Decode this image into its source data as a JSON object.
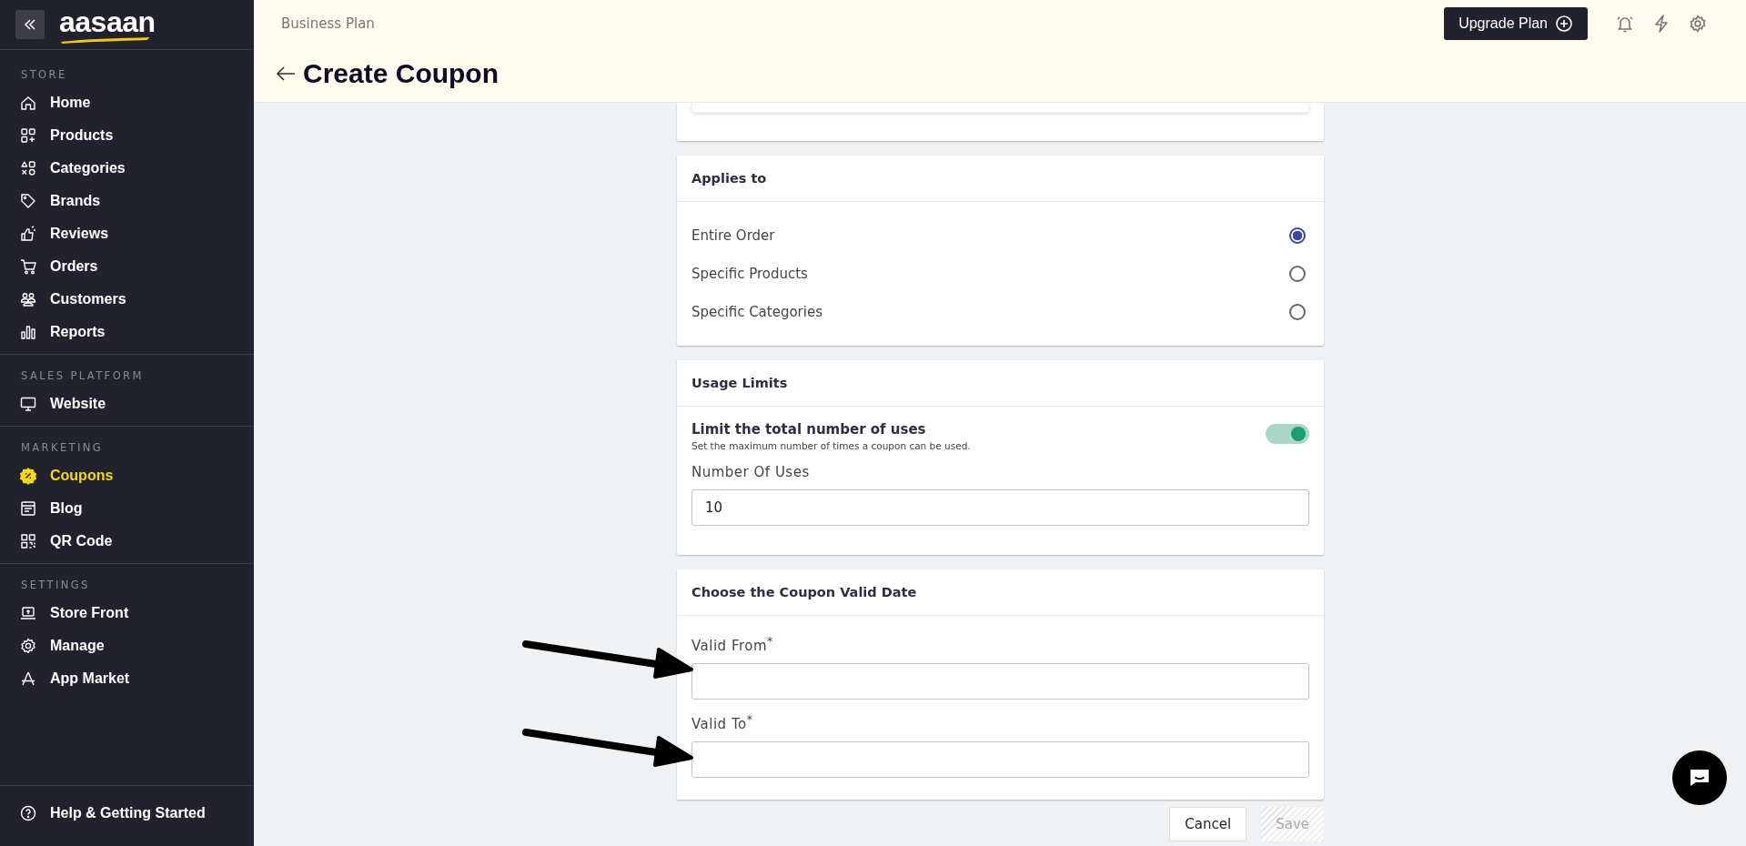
{
  "sidebar": {
    "logo": "aasaan",
    "sections": [
      {
        "title": "STORE",
        "items": [
          {
            "label": "Home",
            "selected": false
          },
          {
            "label": "Products",
            "selected": false
          },
          {
            "label": "Categories",
            "selected": false
          },
          {
            "label": "Brands",
            "selected": false
          },
          {
            "label": "Reviews",
            "selected": false
          },
          {
            "label": "Orders",
            "selected": false
          },
          {
            "label": "Customers",
            "selected": false
          },
          {
            "label": "Reports",
            "selected": false
          }
        ]
      },
      {
        "title": "SALES PLATFORM",
        "items": [
          {
            "label": "Website",
            "selected": false
          }
        ]
      },
      {
        "title": "MARKETING",
        "items": [
          {
            "label": "Coupons",
            "selected": true
          },
          {
            "label": "Blog",
            "selected": false
          },
          {
            "label": "QR Code",
            "selected": false
          }
        ]
      },
      {
        "title": "SETTINGS",
        "items": [
          {
            "label": "Store Front",
            "selected": false
          },
          {
            "label": "Manage",
            "selected": false
          },
          {
            "label": "App Market",
            "selected": false
          }
        ]
      }
    ],
    "footer": {
      "label": "Help & Getting Started"
    }
  },
  "header": {
    "plan": "Business Plan",
    "upgrade_button": "Upgrade Plan",
    "title": "Create Coupon"
  },
  "applies_to": {
    "title": "Applies to",
    "options": [
      {
        "label": "Entire Order",
        "selected": true
      },
      {
        "label": "Specific Products",
        "selected": false
      },
      {
        "label": "Specific Categories",
        "selected": false
      }
    ]
  },
  "usage_limits": {
    "title": "Usage Limits",
    "toggle": {
      "label": "Limit the total number of uses",
      "description": "Set the maximum number of times a coupon can be used.",
      "on": true
    },
    "field": {
      "label": "Number Of Uses",
      "value": "10"
    }
  },
  "valid_date": {
    "title": "Choose the Coupon Valid Date",
    "fields": [
      {
        "label": "Valid From$^{*}$"
      },
      {
        "label": "Valid To$^{*}$"
      }
    ]
  },
  "actions": {
    "cancel": "Cancel",
    "save": {
      "label": "Save",
      "disabled": true
    }
  }
}
